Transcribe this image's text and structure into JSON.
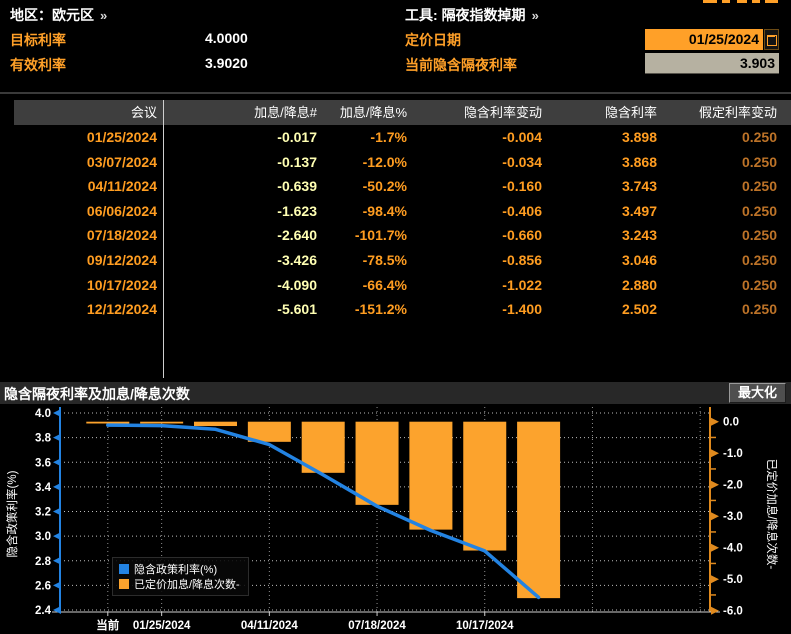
{
  "header": {
    "region_label": "地区：",
    "region_value": "欧元区",
    "region_more": "»",
    "tool_label": "工具:",
    "tool_value": "隔夜指数掉期",
    "tool_more": "»",
    "target_rate_label": "目标利率",
    "target_rate_value": "4.0000",
    "effective_rate_label": "有效利率",
    "effective_rate_value": "3.9020",
    "pricing_date_label": "定价日期",
    "pricing_date_value": "01/25/2024",
    "current_implied_label": "当前隐含隔夜利率",
    "current_implied_value": "3.903"
  },
  "table": {
    "columns": [
      "会议",
      "加息/降息#",
      "加息/降息%",
      "隐含利率变动",
      "隐含利率",
      "假定利率变动"
    ],
    "rows": [
      [
        "01/25/2024",
        "-0.017",
        "-1.7%",
        "-0.004",
        "3.898",
        "0.250"
      ],
      [
        "03/07/2024",
        "-0.137",
        "-12.0%",
        "-0.034",
        "3.868",
        "0.250"
      ],
      [
        "04/11/2024",
        "-0.639",
        "-50.2%",
        "-0.160",
        "3.743",
        "0.250"
      ],
      [
        "06/06/2024",
        "-1.623",
        "-98.4%",
        "-0.406",
        "3.497",
        "0.250"
      ],
      [
        "07/18/2024",
        "-2.640",
        "-101.7%",
        "-0.660",
        "3.243",
        "0.250"
      ],
      [
        "09/12/2024",
        "-3.426",
        "-78.5%",
        "-0.856",
        "3.046",
        "0.250"
      ],
      [
        "10/17/2024",
        "-4.090",
        "-66.4%",
        "-1.022",
        "2.880",
        "0.250"
      ],
      [
        "12/12/2024",
        "-5.601",
        "-151.2%",
        "-1.400",
        "2.502",
        "0.250"
      ]
    ]
  },
  "chart": {
    "title": "隐含隔夜利率及加息/降息次数",
    "maximize_label": "最大化"
  },
  "chart_data": {
    "type": "line+bar",
    "categories": [
      "当前",
      "01/25/2024",
      "03/07/2024",
      "04/11/2024",
      "06/06/2024",
      "07/18/2024",
      "09/12/2024",
      "10/17/2024",
      "12/12/2024"
    ],
    "x_labels_shown": [
      "当前",
      "01/25/2024",
      "04/11/2024",
      "07/18/2024",
      "10/17/2024"
    ],
    "series": [
      {
        "name": "隐含政策利率(%)",
        "type": "line",
        "axis": "left",
        "color": "#2383e2",
        "values": [
          3.902,
          3.898,
          3.868,
          3.743,
          3.497,
          3.243,
          3.046,
          2.88,
          2.502
        ]
      },
      {
        "name": "已定价加息/降息次数-",
        "type": "bar",
        "axis": "right",
        "color": "#fca32d",
        "values": [
          0.0,
          -0.017,
          -0.137,
          -0.639,
          -1.623,
          -2.64,
          -3.426,
          -4.09,
          -5.601
        ]
      }
    ],
    "left_axis": {
      "label": "隐含政策利率(%)",
      "min": 2.4,
      "max": 4.0,
      "step": 0.2
    },
    "right_axis": {
      "label": "已定价加息/降息次数-",
      "min": -6.0,
      "max": 0.0,
      "step": 1.0
    },
    "grid": "dotted",
    "legend_position": "bottom-left"
  },
  "colors": {
    "accent_orange": "#ffa028",
    "value_orange": "#ff9d21",
    "pale_yellow": "#ffffb3",
    "dim_orange": "#bd7328",
    "line_blue": "#2383e2",
    "bar_orange": "#fca32d",
    "header_gray": "#3e3e3e"
  }
}
